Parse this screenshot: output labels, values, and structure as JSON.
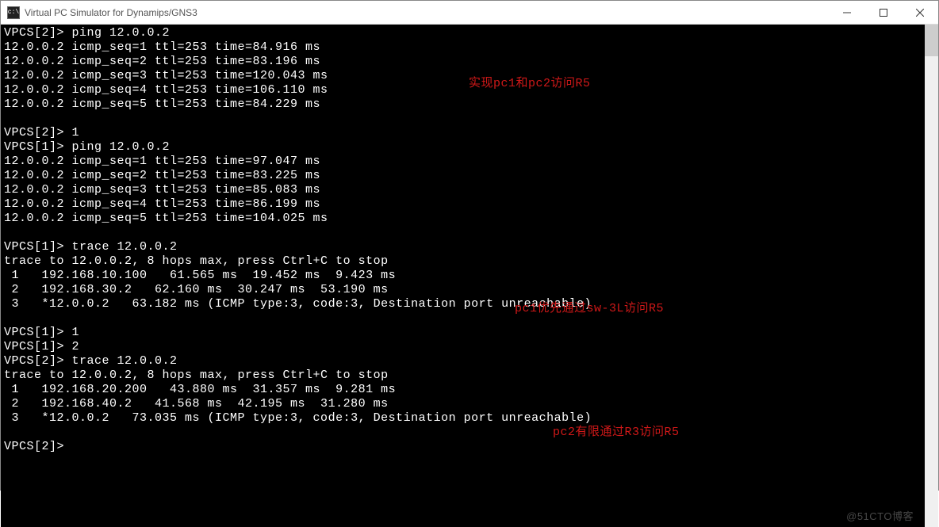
{
  "window": {
    "title": "Virtual PC Simulator for Dynamips/GNS3",
    "icon_label": "c:\\"
  },
  "annotations": {
    "a1": "实现pc1和pc2访问R5",
    "a2": "pc1优先通过sw-3L访问R5",
    "a3": "pc2有限通过R3访问R5"
  },
  "terminal": {
    "lines": [
      "VPCS[2]> ping 12.0.0.2",
      "12.0.0.2 icmp_seq=1 ttl=253 time=84.916 ms",
      "12.0.0.2 icmp_seq=2 ttl=253 time=83.196 ms",
      "12.0.0.2 icmp_seq=3 ttl=253 time=120.043 ms",
      "12.0.0.2 icmp_seq=4 ttl=253 time=106.110 ms",
      "12.0.0.2 icmp_seq=5 ttl=253 time=84.229 ms",
      "",
      "VPCS[2]> 1",
      "VPCS[1]> ping 12.0.0.2",
      "12.0.0.2 icmp_seq=1 ttl=253 time=97.047 ms",
      "12.0.0.2 icmp_seq=2 ttl=253 time=83.225 ms",
      "12.0.0.2 icmp_seq=3 ttl=253 time=85.083 ms",
      "12.0.0.2 icmp_seq=4 ttl=253 time=86.199 ms",
      "12.0.0.2 icmp_seq=5 ttl=253 time=104.025 ms",
      "",
      "VPCS[1]> trace 12.0.0.2",
      "trace to 12.0.0.2, 8 hops max, press Ctrl+C to stop",
      " 1   192.168.10.100   61.565 ms  19.452 ms  9.423 ms",
      " 2   192.168.30.2   62.160 ms  30.247 ms  53.190 ms",
      " 3   *12.0.0.2   63.182 ms (ICMP type:3, code:3, Destination port unreachable)",
      "",
      "VPCS[1]> 1",
      "VPCS[1]> 2",
      "VPCS[2]> trace 12.0.0.2",
      "trace to 12.0.0.2, 8 hops max, press Ctrl+C to stop",
      " 1   192.168.20.200   43.880 ms  31.357 ms  9.281 ms",
      " 2   192.168.40.2   41.568 ms  42.195 ms  31.280 ms",
      " 3   *12.0.0.2   73.035 ms (ICMP type:3, code:3, Destination port unreachable)",
      "",
      "VPCS[2]> "
    ]
  },
  "watermark": "@51CTO博客"
}
